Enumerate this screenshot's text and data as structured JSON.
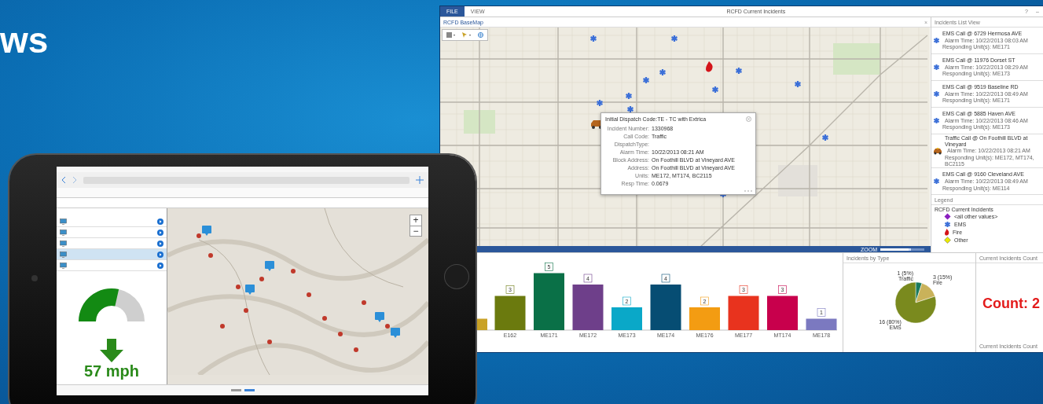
{
  "heading": "ws",
  "app": {
    "tabs": [
      {
        "label": "FILE",
        "selected": true
      },
      {
        "label": "VIEW",
        "selected": false
      }
    ],
    "title": "RCFD Current Incidents",
    "window_buttons": [
      "?",
      "–"
    ],
    "map": {
      "title": "RCFD BaseMap",
      "close": "×",
      "zoom": {
        "label": "ZOOM",
        "level": 0.7
      },
      "popup": {
        "title": "Initial Dispatch Code:TE - TC with Extrica",
        "fields": [
          {
            "label": "Incident Number:",
            "value": "1330968"
          },
          {
            "label": "Call Code:",
            "value": "Traffic"
          },
          {
            "label": "DispatchType:"
          },
          {
            "label": "Alarm Time:",
            "value": "10/22/2013 08:21 AM"
          },
          {
            "label": "Block Address:",
            "value": "On Foothill BLVD at Vineyard AVE"
          },
          {
            "label": "Address:",
            "value": "On Foothill BLVD at Vineyard AVE"
          },
          {
            "label": "Units:",
            "value": "ME172, MT174, BC2115"
          },
          {
            "label": "Resp Time:",
            "value": "0.0679"
          }
        ]
      }
    },
    "incidents": {
      "title": "Incidents List View",
      "items": [
        {
          "kind": "ems",
          "title": "EMS Call @ 6729 Hermosa AVE",
          "time": "Alarm Time: 10/22/2013 08:03 AM",
          "units": "Responding Unit(s): ME171"
        },
        {
          "kind": "ems",
          "title": "EMS Call @ 11976 Dorset ST",
          "time": "Alarm Time: 10/22/2013 08:29 AM",
          "units": "Responding Unit(s): ME173"
        },
        {
          "kind": "ems",
          "title": "EMS Call @ 9519 Baseline RD",
          "time": "Alarm Time: 10/22/2013 08:49 AM",
          "units": "Responding Unit(s): ME171"
        },
        {
          "kind": "ems",
          "title": "EMS Call @ 5885 Haven AVE",
          "time": "Alarm Time: 10/22/2013 08:46 AM",
          "units": "Responding Unit(s): ME173"
        },
        {
          "kind": "traffic",
          "title": "Traffic Call @ On Foothill BLVD at Vineyard",
          "time": "Alarm Time: 10/22/2013 08:21 AM",
          "units": "Responding Unit(s): ME172, MT174, BC2115"
        },
        {
          "kind": "ems",
          "title": "EMS Call @ 9160 Cleveland AVE",
          "time": "Alarm Time: 10/22/2013 08:49 AM",
          "units": "Responding Unit(s): ME114"
        }
      ]
    },
    "legend": {
      "title": "Legend",
      "layer": "RCFD Current Incidents",
      "items": [
        {
          "kind": "other-values",
          "label": "<all other values>"
        },
        {
          "kind": "ems",
          "label": "EMS"
        },
        {
          "kind": "fire",
          "label": "Fire"
        },
        {
          "kind": "other",
          "label": "Other"
        }
      ]
    },
    "units_chart": {
      "chart_data": {
        "type": "bar",
        "categories": [
          "E162",
          "ME171",
          "ME172",
          "ME173",
          "ME174",
          "ME176",
          "ME177",
          "MT174",
          "ME178"
        ],
        "data_labels": true,
        "values": [
          3,
          5,
          4,
          2,
          4,
          2,
          3,
          3,
          1
        ],
        "colors": [
          "#6b7a0e",
          "#0a7047",
          "#6e3f8a",
          "#0aa8c8",
          "#064d73",
          "#f39c12",
          "#e8331e",
          "#c8004c",
          "#7b79c0"
        ]
      }
    },
    "type_chart": {
      "title": "Incidents by Type",
      "chart_data": {
        "type": "pie",
        "categories": [
          "Traffic",
          "Fire",
          "EMS"
        ],
        "values": [
          5,
          15,
          80
        ],
        "colors": [
          "#1a7a5e",
          "#c9b25a",
          "#7a8a1e"
        ],
        "value_labels": [
          "1 (5%)",
          "3 (15%)",
          "16 (80%)"
        ]
      }
    },
    "count": {
      "title": "Current Incidents Count",
      "value": "Count: 2",
      "footer": "Current Incidents Count"
    }
  },
  "tablet": {
    "map_zoom": [
      "+",
      "−"
    ],
    "list": [
      {
        "selected": false
      },
      {
        "selected": false
      },
      {
        "selected": false
      },
      {
        "selected": true
      },
      {
        "selected": false
      }
    ],
    "gauge": {
      "level": 0.57
    },
    "speed": "57 mph"
  }
}
